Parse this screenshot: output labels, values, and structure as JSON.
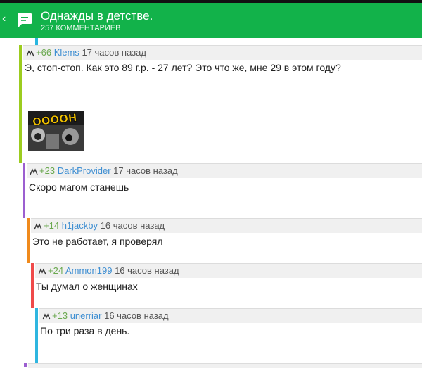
{
  "appbar": {
    "back_glyph": "‹",
    "icon": "chat-bubble-icon",
    "title": "Однажды в детстве.",
    "subtitle": "257 КОММЕНТАРИЕВ",
    "color": "#12b24a"
  },
  "comments": [
    {
      "rating": "+66",
      "user": "Klems",
      "time": "17 часов назад",
      "text": "Э, стоп-стоп. Как это 89 г.р. - 27 лет? Это что же, мне 29 в этом году?",
      "image": "yeeeah-meme-thumbnail",
      "image_text": "OOOOH",
      "bar_color": "#9ccc1f"
    },
    {
      "rating": "+23",
      "user": "DarkProvider",
      "time": "17 часов назад",
      "text": "Скоро магом станешь",
      "bar_color": "#9c5fd0"
    },
    {
      "rating": "+14",
      "user": "h1jackby",
      "time": "16 часов назад",
      "text": "Это не работает, я проверял",
      "bar_color": "#f08a1c"
    },
    {
      "rating": "+24",
      "user": "Ammon199",
      "time": "16 часов назад",
      "text": "Ты думал о женщинах",
      "bar_color": "#ef4a4a"
    },
    {
      "rating": "+13",
      "user": "unerriar",
      "time": "16 часов назад",
      "text": "По три раза в день.",
      "bar_color": "#2fb6e0"
    }
  ]
}
